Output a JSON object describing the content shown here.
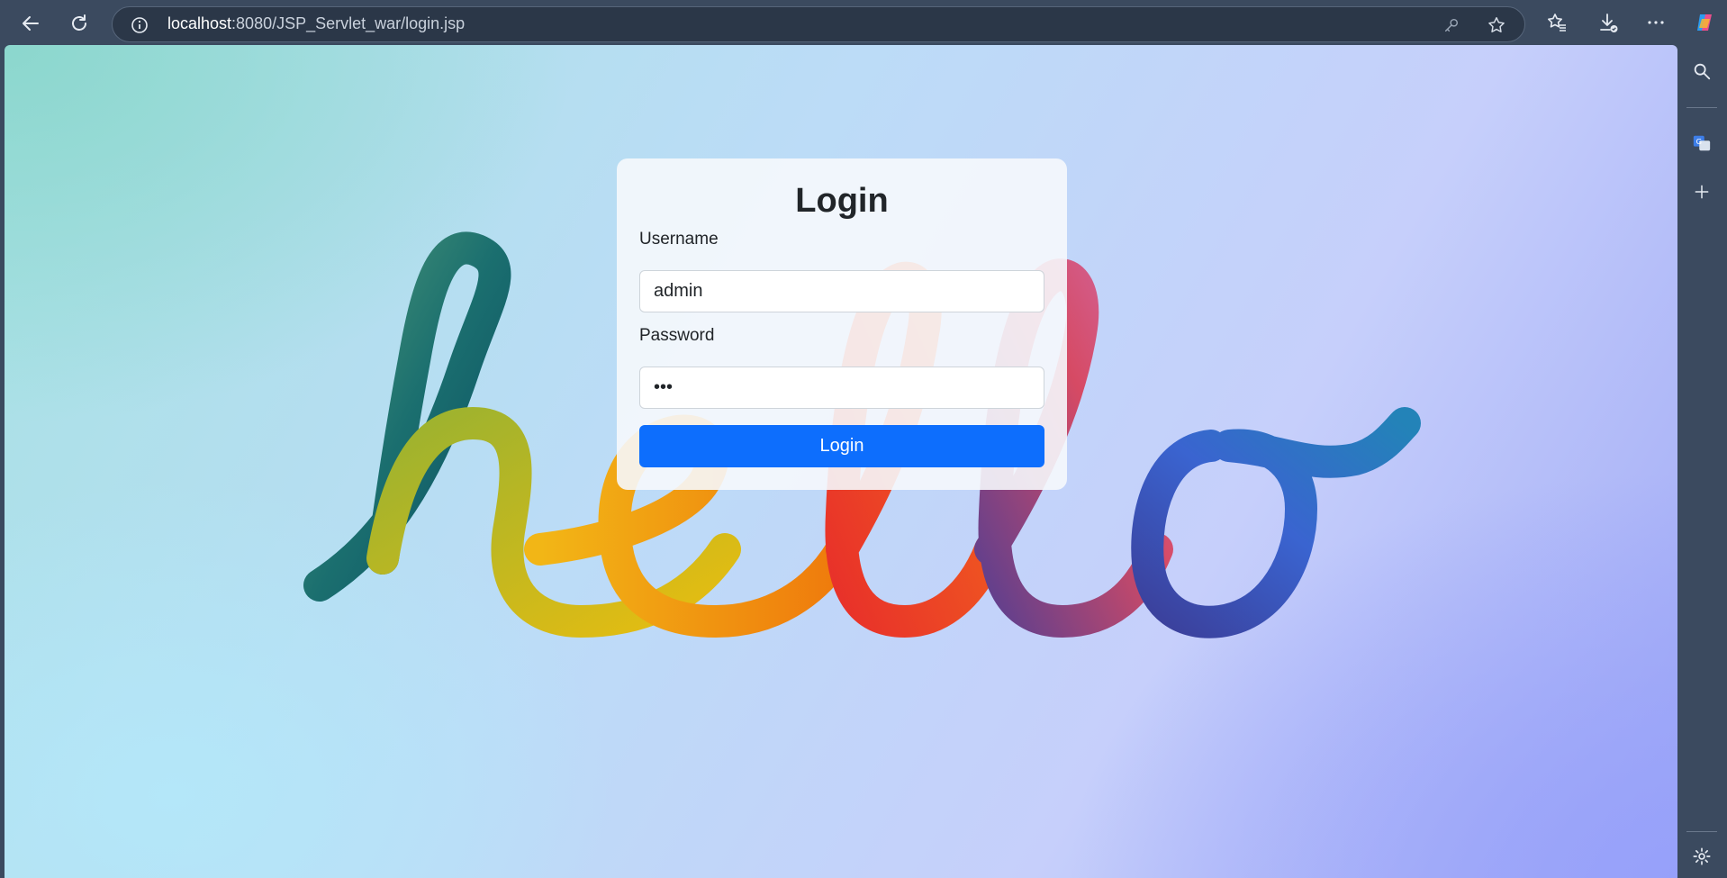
{
  "browser": {
    "url_host": "localhost",
    "url_path": ":8080/JSP_Servlet_war/login.jsp",
    "icons": [
      "back-icon",
      "refresh-icon",
      "info-icon",
      "key-icon",
      "star-icon",
      "favorites-icon",
      "downloads-icon",
      "more-icon",
      "copilot-icon"
    ]
  },
  "sidebar": {
    "icons": [
      "search-icon",
      "translate-icon",
      "plus-icon",
      "settings-icon"
    ]
  },
  "background": {
    "art_text": "hello"
  },
  "login": {
    "title": "Login",
    "username_label": "Username",
    "username_value": "admin",
    "password_label": "Password",
    "password_value": "•••",
    "button_label": "Login"
  },
  "colors": {
    "accent": "#0d6efd",
    "chrome": "#3b4a5f"
  }
}
